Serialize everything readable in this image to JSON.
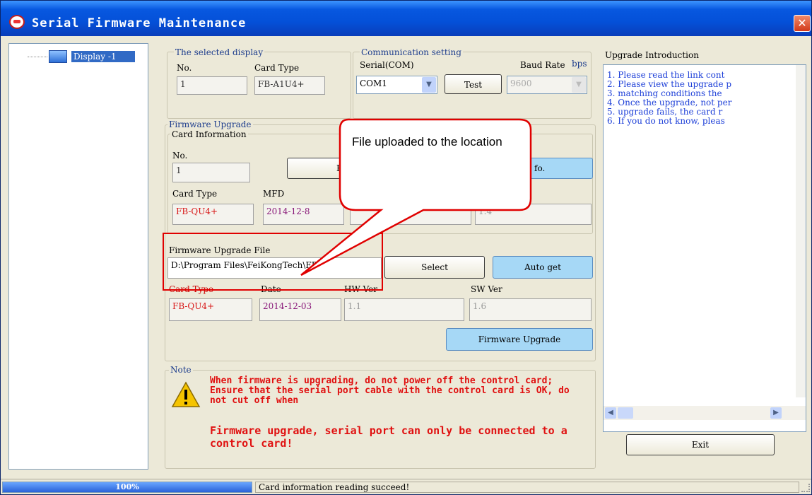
{
  "window": {
    "title": "Serial Firmware Maintenance",
    "close_glyph": "✕"
  },
  "tree": {
    "item_label": "Display -1"
  },
  "selected_display": {
    "legend": "The selected display",
    "no_label": "No.",
    "card_type_label": "Card Type",
    "no_value": "1",
    "card_type_value": "FB-A1U4+"
  },
  "comm": {
    "legend": "Communication setting",
    "serial_label": "Serial(COM)",
    "baud_label": "Baud Rate",
    "baud_unit": "bps",
    "serial_value": "COM1",
    "test_label": "Test",
    "baud_value": "9600"
  },
  "firmware": {
    "legend": "Firmware Upgrade",
    "card_info_legend": "Card Information",
    "no_label": "No.",
    "no_value": "1",
    "read_button_partial": "R",
    "info_button_partial": "fo.",
    "card_type_label": "Card Type",
    "mfd_label": "MFD",
    "card_type_value": "FB-QU4+",
    "mfd_value": "2014-12-8",
    "extra_value": "1.4",
    "file_label": "Firmware Upgrade File",
    "file_value": "D:\\Program Files\\FeiKongTech\\FB",
    "select_label": "Select",
    "auto_get_label": "Auto get",
    "file_card_type_label": "Card Type",
    "date_label": "Date",
    "hw_label": "HW Ver",
    "sw_label": "SW Ver",
    "file_card_type_value": "FB-QU4+",
    "date_value": "2014-12-03",
    "hw_value": "1.1",
    "sw_value": "1.6",
    "upgrade_button": "Firmware Upgrade"
  },
  "note": {
    "legend": "Note",
    "text1": "When firmware is upgrading, do not power off the control card; Ensure that the serial port cable with the control card is OK, do not cut off when",
    "text2": "Firmware upgrade, serial port can only be connected to a control card!"
  },
  "intro": {
    "title": "Upgrade Introduction",
    "items": [
      "1. Please read the link cont",
      "2. Please view the upgrade p",
      "3. matching conditions  the",
      "4. Once the upgrade, not per",
      "5. upgrade fails, the card r",
      "6. If you do not know, pleas"
    ],
    "exit_label": "Exit"
  },
  "callout": {
    "text": "File uploaded to the location",
    "color": "#e00000"
  },
  "status": {
    "progress_text": "100%",
    "progress": 1.0,
    "message": "Card information reading succeed!"
  }
}
